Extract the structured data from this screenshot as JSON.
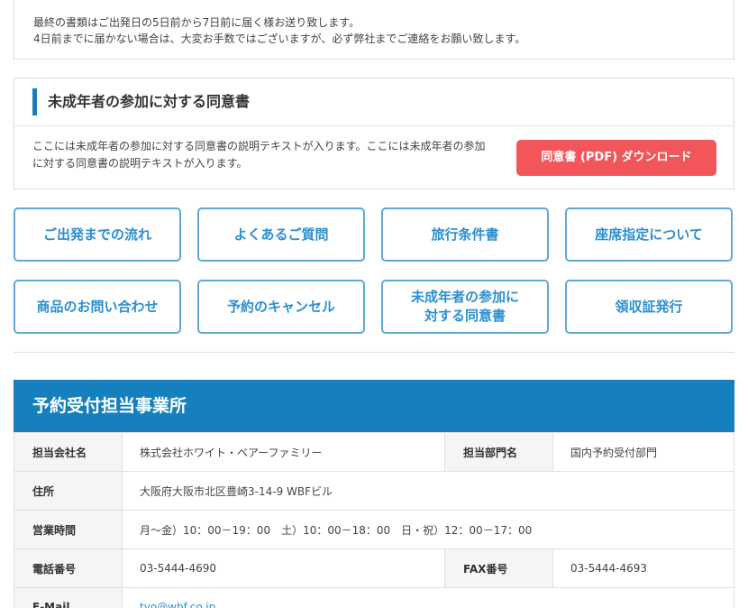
{
  "notice": {
    "line1": "最終の書類はご出発日の5日前から7日前に届く様お送り致します。",
    "line2": "4日前までに届かない場合は、大変お手数ではございますが、必ず弊社までご連絡をお願い致します。"
  },
  "consent": {
    "heading": "未成年者の参加に対する同意書",
    "description": "ここには未成年者の参加に対する同意書の説明テキストが入ります。ここには未成年者の参加に対する同意書の説明テキストが入ります。",
    "download_label": "同意書 (PDF) ダウンロード",
    "accent_color": "#1a7fb8",
    "button_color": "#f2555a"
  },
  "nav_buttons": [
    {
      "label": "ご出発までの流れ"
    },
    {
      "label": "よくあるご質問"
    },
    {
      "label": "旅行条件書"
    },
    {
      "label": "座席指定について"
    },
    {
      "label": "商品のお問い合わせ"
    },
    {
      "label": "予約のキャンセル"
    },
    {
      "label": "未成年者の参加に\n対する同意書"
    },
    {
      "label": "領収証発行"
    }
  ],
  "office": {
    "title": "予約受付担当事業所",
    "header_color": "#1580bd",
    "company_label": "担当会社名",
    "company_value": "株式会社ホワイト・ベアーファミリー",
    "dept_label": "担当部門名",
    "dept_value": "国内予約受付部門",
    "address_label": "住所",
    "address_value": "大阪府大阪市北区豊崎3-14-9 WBFビル",
    "hours_label": "営業時間",
    "hours_value": "月〜金）10：00－19：00　土）10：00－18：00　日・祝）12：00－17：00",
    "phone_label": "電話番号",
    "phone_value": "03-5444-4690",
    "fax_label": "FAX番号",
    "fax_value": "03-5444-4693",
    "email_label": "E-Mail",
    "email_value": "tyo@wbf.co.jp"
  }
}
